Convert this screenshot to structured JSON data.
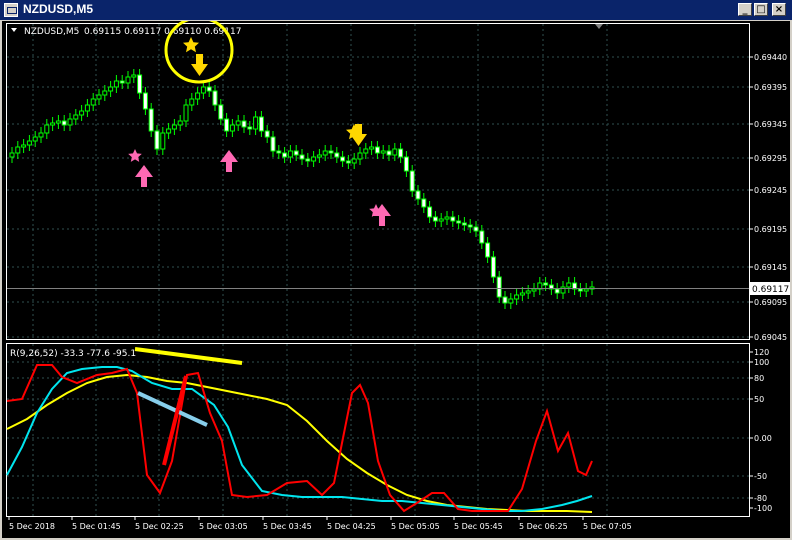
{
  "window": {
    "title": "NZDUSD,M5",
    "minimize_glyph": "_",
    "restore_glyph": "□",
    "close_glyph": "×"
  },
  "price_panel": {
    "symbol_label": "NZDUSD,M5",
    "ohlc_text": "0.69115 0.69117 0.69110 0.69117",
    "current_price": "0.69117",
    "price_labels": [
      "0.69440",
      "0.69395",
      "0.69345",
      "0.69295",
      "0.69245",
      "0.69195",
      "0.69145",
      "0.69095",
      "0.69045"
    ]
  },
  "indicator_panel": {
    "label": "R(9,26,52) -33.3 -77.6 -95.1",
    "scale_labels": [
      "120",
      "100",
      "80",
      "50",
      "0.00",
      "-50",
      "-80",
      "-100"
    ]
  },
  "time_labels": [
    "5 Dec 2018",
    "5 Dec 01:45",
    "5 Dec 02:25",
    "5 Dec 03:05",
    "5 Dec 03:45",
    "5 Dec 04:25",
    "5 Dec 05:05",
    "5 Dec 05:45",
    "5 Dec 06:25",
    "5 Dec 07:05"
  ],
  "colors": {
    "background": "#000000",
    "grid": "#2f4f4f",
    "candle": "#00ff00",
    "axis_text": "#ffffff",
    "series_fast": "#ff0000",
    "series_mid": "#00e5ee",
    "series_slow": "#ffff00",
    "annotation_star_yellow": "#ffd700",
    "annotation_pink": "#ff69b4",
    "annotation_blue": "#87ceeb"
  },
  "icons": {
    "window_icon": "chart-window-icon",
    "minimize": "minimize-icon",
    "restore": "restore-icon",
    "close": "close-icon"
  }
}
